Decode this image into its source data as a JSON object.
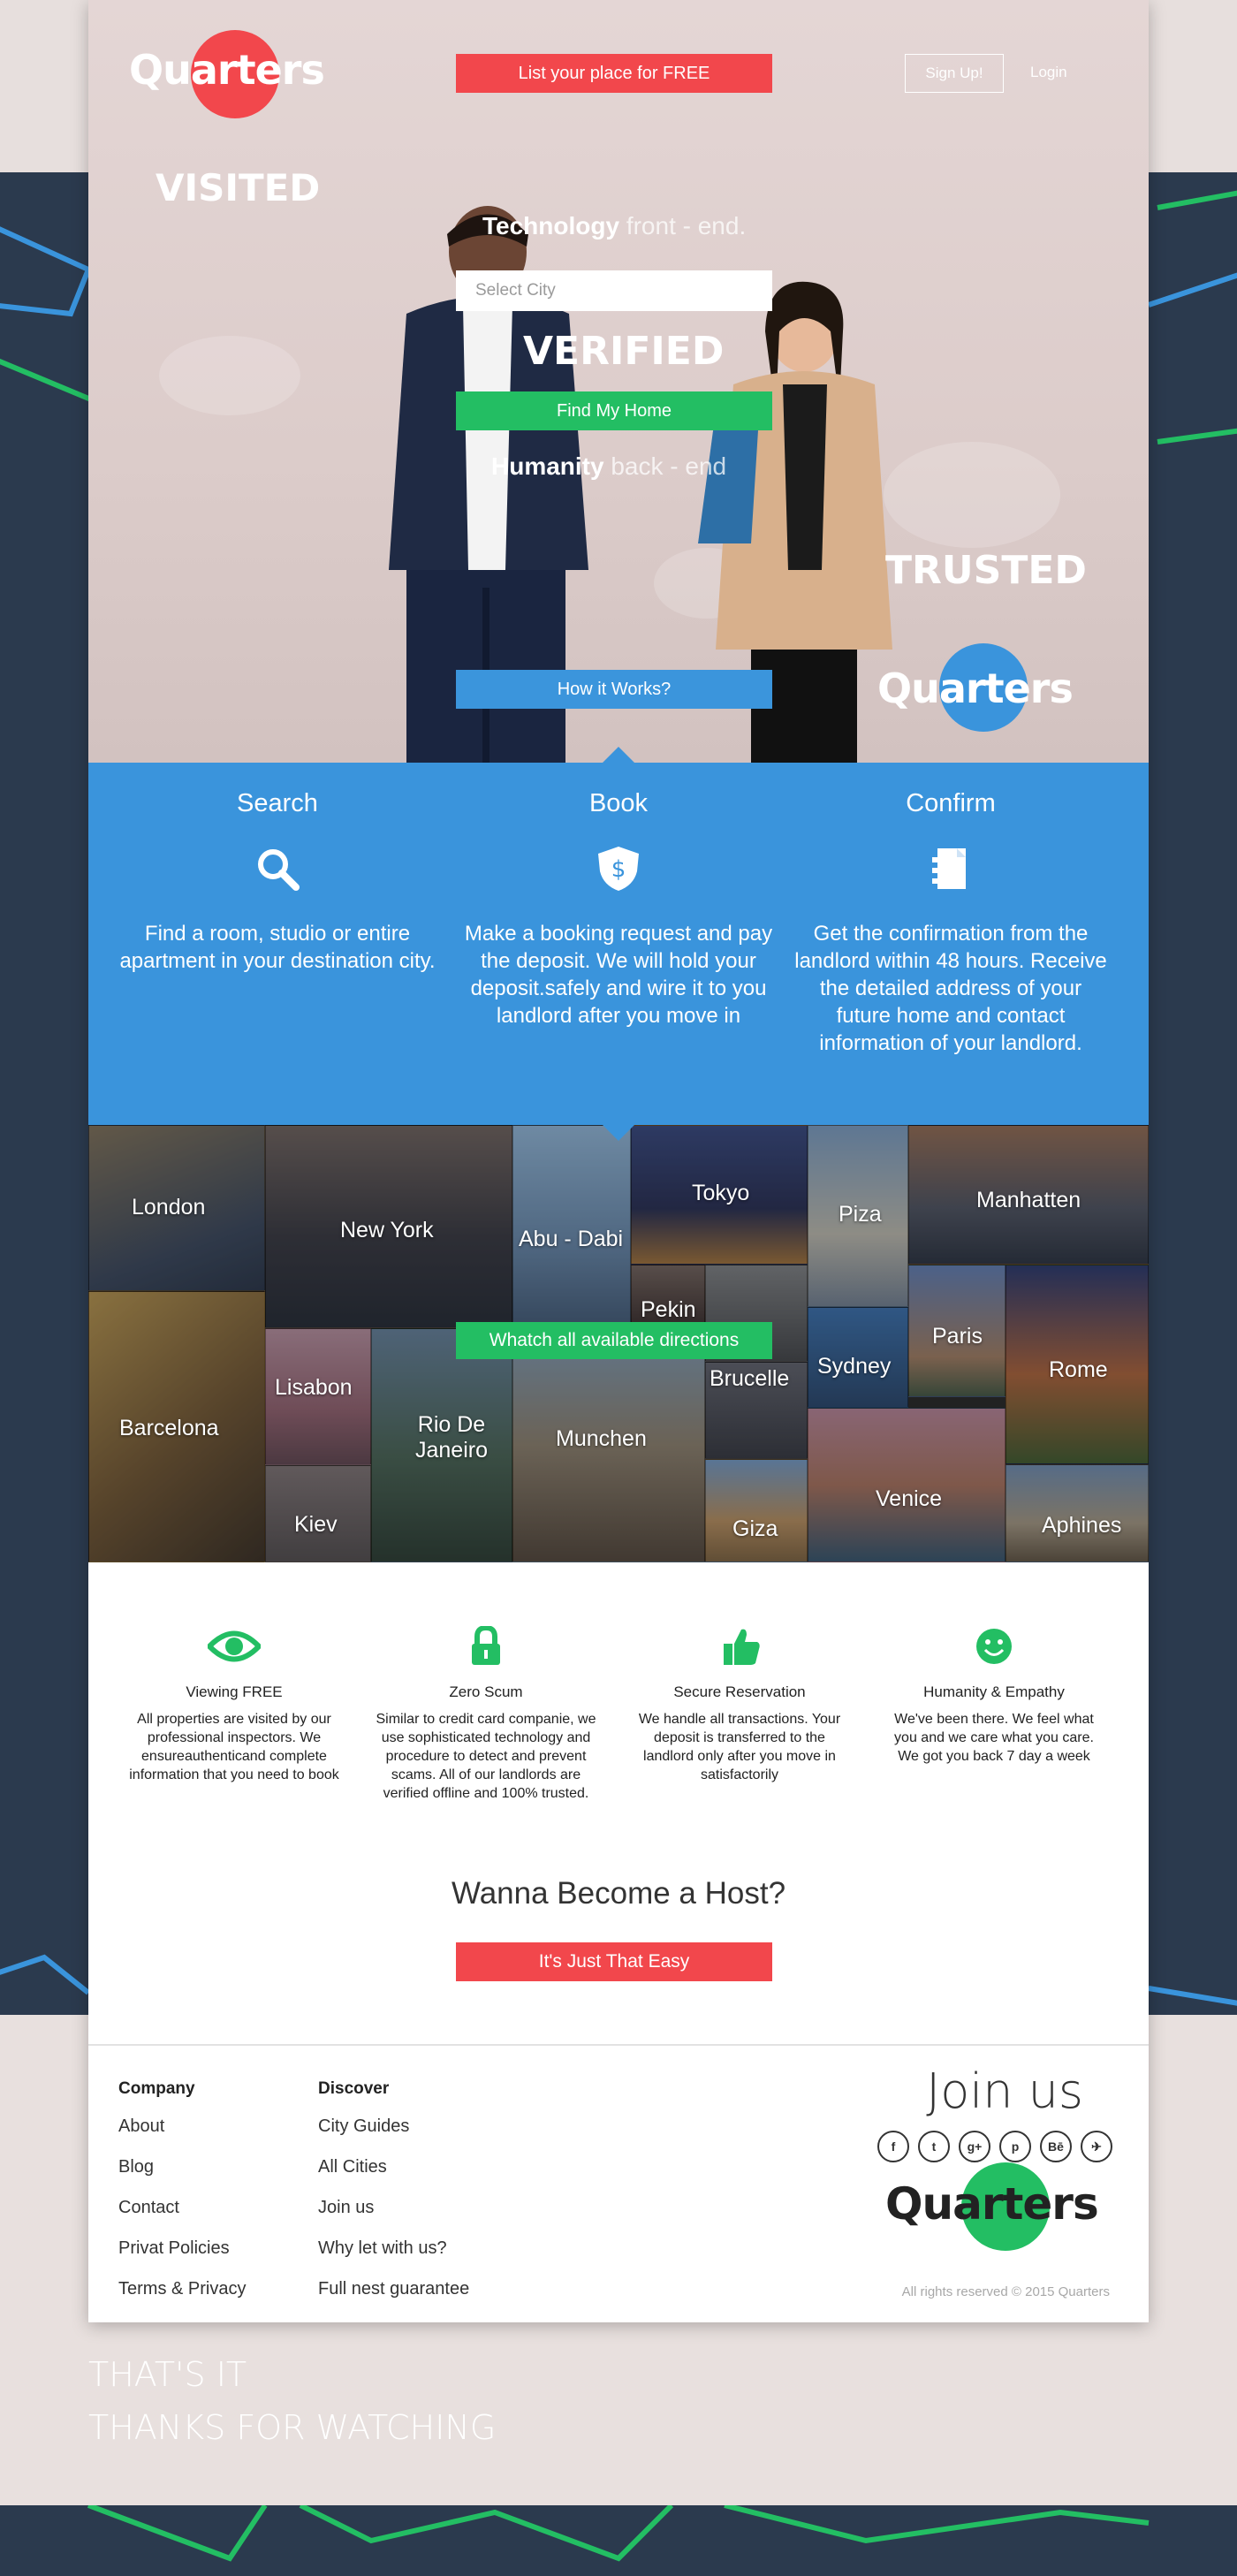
{
  "header": {
    "logo_text": "Quarters",
    "list_place_label": "List your place for FREE",
    "signup_label": "Sign Up!",
    "login_label": "Login"
  },
  "hero": {
    "word_visited": "VISITED",
    "word_verified": "VERIFIED",
    "word_trusted": "TRUSTED",
    "tech_bold": "Technology",
    "tech_light": "front - end.",
    "humanity_bold": "Humanity",
    "humanity_light": "back - end",
    "select_placeholder": "Select City",
    "find_home_label": "Find My Home",
    "how_it_works_label": "How it Works?",
    "logo_text": "Quarters"
  },
  "steps": [
    {
      "title": "Search",
      "icon": "search-icon",
      "text": "Find a room, studio or entire apartment in your destination city."
    },
    {
      "title": "Book",
      "icon": "shield-dollar-icon",
      "text": "Make a booking request and pay the deposit. We will hold your deposit.safely and wire it to you landlord after you move in"
    },
    {
      "title": "Confirm",
      "icon": "document-icon",
      "text": "Get the confirmation from the landlord within 48 hours. Receive the detailed address of your future home and contact information of your landlord."
    }
  ],
  "cities": {
    "button_label": "Whatch all available directions",
    "names": [
      "London",
      "New York",
      "Abu - Dabi",
      "Tokyo",
      "Piza",
      "Manhatten",
      "Pekin",
      "Barcelona",
      "Lisabon",
      "Rio De Janeiro",
      "Munchen",
      "Brucelle",
      "Sydney",
      "Paris",
      "Rome",
      "Kiev",
      "Giza",
      "Venice",
      "Aphines"
    ]
  },
  "features": [
    {
      "title": "Viewing FREE",
      "icon": "eye-icon",
      "text": "All properties are visited by our professional inspectors. We ensureauthenticand complete information that you need to book"
    },
    {
      "title": "Zero Scum",
      "icon": "lock-icon",
      "text": "Similar to credit card companie, we use sophisticated technology and procedure to detect and prevent scams. All of our landlords are verified offline and 100% trusted."
    },
    {
      "title": "Secure Reservation",
      "icon": "thumbs-up-icon",
      "text": "We handle all transactions. Your deposit is transferred to the landlord only after you move in satisfactorily"
    },
    {
      "title": "Humanity & Empathy",
      "icon": "smile-icon",
      "text": "We've been there. We feel what you and we care what you care. We got you back 7 day a week"
    }
  ],
  "host": {
    "title": "Wanna Become a Host?",
    "button_label": "It's Just That Easy"
  },
  "footer": {
    "company_title": "Company",
    "company_links": [
      "About",
      "Blog",
      "Contact",
      "Privat Policies",
      "Terms & Privacy"
    ],
    "discover_title": "Discover",
    "discover_links": [
      "City Guides",
      "All Cities",
      "Join us",
      "Why let with us?",
      "Full nest guarantee"
    ],
    "join_title": "Join us",
    "socials": [
      "f",
      "t",
      "g+",
      "p",
      "Bē",
      "✈"
    ],
    "logo_text": "Quarters",
    "copyright": "All rights reserved © 2015 Quarters"
  },
  "outro": {
    "line1": "THAT'S IT",
    "line2": "THANKS FOR WATCHING"
  },
  "colors": {
    "red": "#f2474c",
    "green": "#23be63",
    "blue": "#3a94dc",
    "navy": "#2b3a4e"
  }
}
